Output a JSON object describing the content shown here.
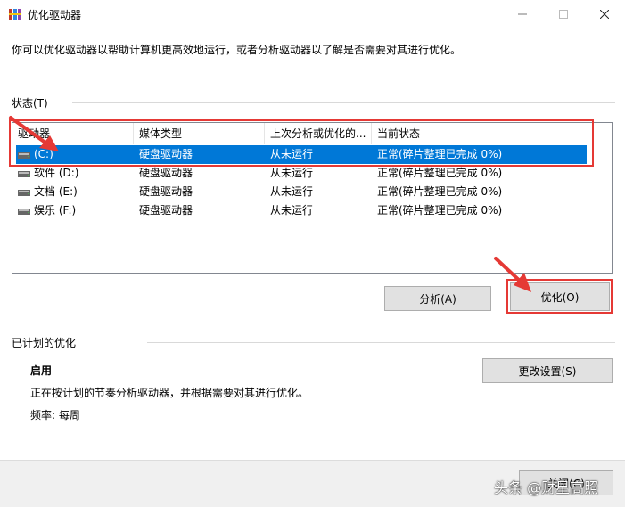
{
  "window": {
    "title": "优化驱动器"
  },
  "description": "你可以优化驱动器以帮助计算机更高效地运行，或者分析驱动器以了解是否需要对其进行优化。",
  "status_section": {
    "label": "状态(T)",
    "columns": [
      "驱动器",
      "媒体类型",
      "上次分析或优化的...",
      "当前状态"
    ],
    "rows": [
      {
        "drive": "(C:)",
        "media": "硬盘驱动器",
        "last_run": "从未运行",
        "status": "正常(碎片整理已完成 0%)",
        "selected": true
      },
      {
        "drive": "软件 (D:)",
        "media": "硬盘驱动器",
        "last_run": "从未运行",
        "status": "正常(碎片整理已完成 0%)",
        "selected": false
      },
      {
        "drive": "文档 (E:)",
        "media": "硬盘驱动器",
        "last_run": "从未运行",
        "status": "正常(碎片整理已完成 0%)",
        "selected": false
      },
      {
        "drive": "娱乐 (F:)",
        "media": "硬盘驱动器",
        "last_run": "从未运行",
        "status": "正常(碎片整理已完成 0%)",
        "selected": false
      }
    ]
  },
  "buttons": {
    "analyze": "分析(A)",
    "optimize": "优化(O)",
    "change_settings": "更改设置(S)",
    "close": "关闭(C)"
  },
  "schedule_section": {
    "label": "已计划的优化",
    "state": "启用",
    "description": "正在按计划的节奏分析驱动器，并根据需要对其进行优化。",
    "frequency": "频率: 每周"
  },
  "watermark": "头条 @财星高照",
  "colors": {
    "selection": "#0078d7",
    "highlight_red": "#e53935"
  },
  "icons": [
    "app-defrag-icon",
    "minimize-icon",
    "maximize-icon",
    "close-icon",
    "drive-icon"
  ]
}
